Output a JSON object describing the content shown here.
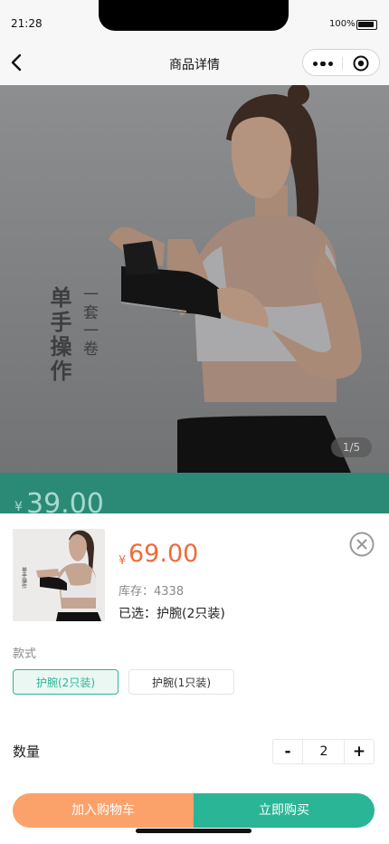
{
  "status_bar": {
    "time": "21:28",
    "battery": "100%"
  },
  "nav": {
    "title": "商品详情"
  },
  "hero": {
    "banner_main": "单手操作",
    "banner_sub": "一套一卷",
    "counter": "1/5",
    "price_symbol": "¥",
    "price": "39.00"
  },
  "sheet": {
    "price_symbol": "¥",
    "price": "69.00",
    "stock": "库存：4338",
    "selected": "已选：护腕(2只装)",
    "spec_label": "款式",
    "options": [
      {
        "label": "护腕(2只装)",
        "active": true
      },
      {
        "label": "护腕(1只装)",
        "active": false
      }
    ],
    "qty_label": "数量",
    "minus": "-",
    "plus": "+",
    "quantity": "2",
    "add_to_cart": "加入购物车",
    "buy_now": "立即购买"
  },
  "colors": {
    "accent": "#2bb597",
    "price": "#f06a3a",
    "cart": "#fba26b"
  },
  "icons": [
    "back-arrow-icon",
    "more-dots-icon",
    "target-icon",
    "close-circle-icon"
  ]
}
